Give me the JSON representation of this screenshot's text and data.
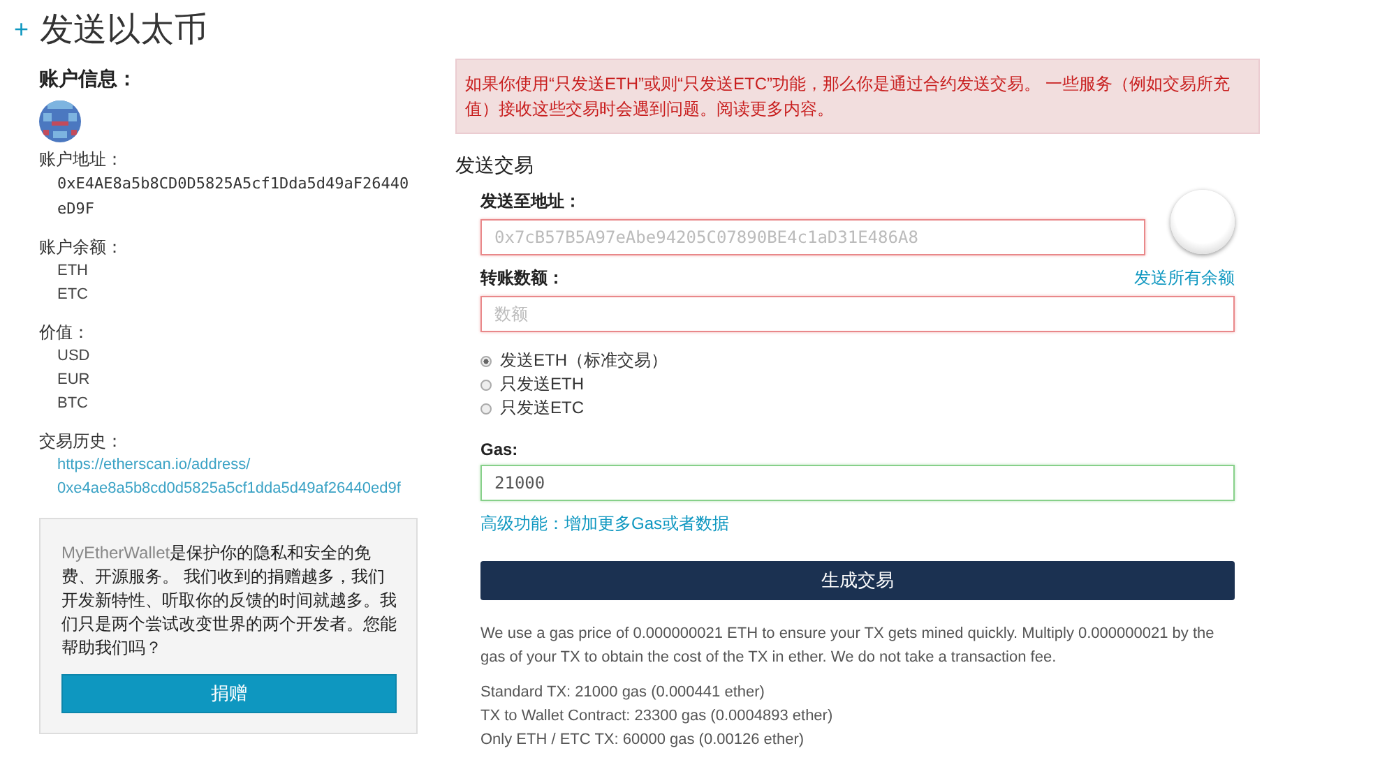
{
  "page": {
    "title": "发送以太币",
    "expand_icon": "+"
  },
  "account": {
    "heading": "账户信息：",
    "address_label": "账户地址：",
    "address": "0xE4AE8a5b8CD0D5825A5cf1Dda5d49aF26440eD9F",
    "balance_label": "账户余额：",
    "balances": [
      "ETH",
      "ETC"
    ],
    "value_label": "价值：",
    "values": [
      "USD",
      "EUR",
      "BTC"
    ],
    "history_label": "交易历史：",
    "history_link": [
      "https://etherscan.io/address/",
      "0xe4ae8a5b8cd0d5825a5cf1dda5d49af26440ed9f"
    ]
  },
  "donate": {
    "brand": "MyEtherWallet",
    "text": "是保护你的隐私和安全的免费、开源服务。 我们收到的捐赠越多，我们开发新特性、听取你的反馈的时间就越多。我们只是两个尝试改变世界的两个开发者。您能帮助我们吗？",
    "button": "捐赠"
  },
  "warning": "如果你使用“只发送ETH”或则“只发送ETC”功能，那么你是通过合约发送交易。 一些服务（例如交易所充值）接收这些交易时会遇到问题。阅读更多内容。",
  "send": {
    "heading": "发送交易",
    "to_label": "发送至地址：",
    "to_placeholder": "0x7cB57B5A97eAbe94205C07890BE4c1aD31E486A8",
    "amount_label": "转账数额：",
    "send_all": "发送所有余额",
    "amount_placeholder": "数额",
    "options": [
      {
        "label": "发送ETH（标准交易）",
        "selected": true
      },
      {
        "label": "只发送ETH",
        "selected": false
      },
      {
        "label": "只发送ETC",
        "selected": false
      }
    ],
    "gas_label": "Gas:",
    "gas_value": "21000",
    "advanced": "高级功能：增加更多Gas或者数据",
    "generate": "生成交易"
  },
  "notes": [
    "We use a gas price of 0.000000021 ETH to ensure your TX gets mined quickly. Multiply 0.000000021 by the gas of your TX to obtain the cost of the TX in ether. We do not take a transaction fee.",
    "Standard TX: 21000 gas (0.000441 ether)",
    "TX to Wallet Contract: 23300 gas (0.0004893 ether)",
    "Only ETH / ETC TX: 60000 gas (0.00126 ether)"
  ]
}
